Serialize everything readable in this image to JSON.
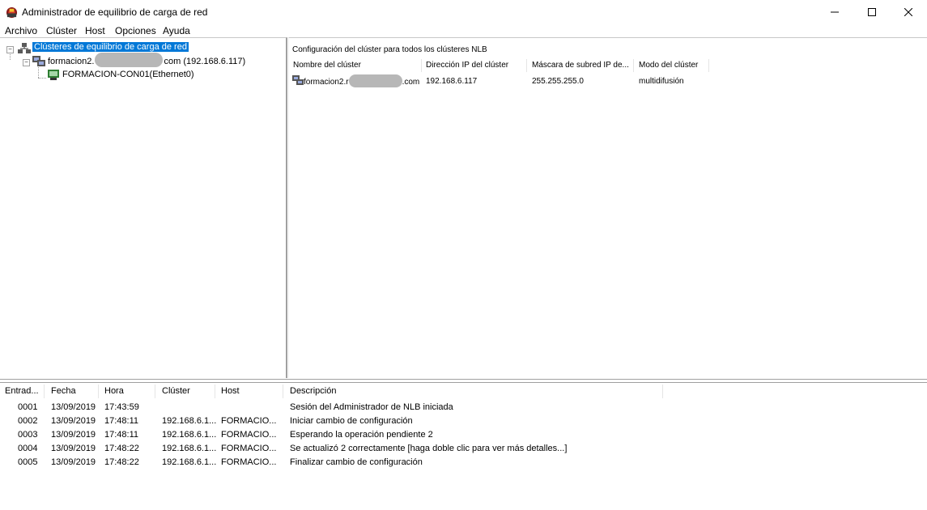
{
  "window": {
    "title": "Administrador de equilibrio de carga de red",
    "icon": "nlb-manager-icon",
    "controls": [
      "minimize",
      "maximize",
      "close"
    ]
  },
  "menu": {
    "items": [
      "Archivo",
      "Clúster",
      "Host",
      "Opciones",
      "Ayuda"
    ]
  },
  "tree": {
    "root_label": "Clústeres de equilibrio de carga de red",
    "cluster_prefix": "formacion2.",
    "cluster_suffix": "com (192.168.6.117)",
    "host_label": "FORMACION-CON01(Ethernet0)"
  },
  "cluster_panel": {
    "title": "Configuración del clúster para todos los clústeres NLB",
    "columns": [
      "Nombre del clúster",
      "Dirección IP del clúster",
      "Máscara de subred IP de...",
      "Modo del clúster"
    ],
    "row": {
      "name_prefix": "formacion2.r",
      "name_suffix": ".com",
      "ip": "192.168.6.117",
      "mask": "255.255.255.0",
      "mode": "multidifusión"
    }
  },
  "log": {
    "columns": [
      "Entrad...",
      "Fecha",
      "Hora",
      "Clúster",
      "Host",
      "Descripción"
    ],
    "rows": [
      {
        "entry": "0001",
        "date": "13/09/2019",
        "time": "17:43:59",
        "cluster": "",
        "host": "",
        "desc": "Sesión del Administrador de NLB iniciada"
      },
      {
        "entry": "0002",
        "date": "13/09/2019",
        "time": "17:48:11",
        "cluster": "192.168.6.1...",
        "host": "FORMACIO...",
        "desc": "Iniciar cambio de configuración"
      },
      {
        "entry": "0003",
        "date": "13/09/2019",
        "time": "17:48:11",
        "cluster": "192.168.6.1...",
        "host": "FORMACIO...",
        "desc": "Esperando la operación pendiente 2"
      },
      {
        "entry": "0004",
        "date": "13/09/2019",
        "time": "17:48:22",
        "cluster": "192.168.6.1...",
        "host": "FORMACIO...",
        "desc": "Se actualizó 2 correctamente [haga doble clic para ver más detalles...]"
      },
      {
        "entry": "0005",
        "date": "13/09/2019",
        "time": "17:48:22",
        "cluster": "192.168.6.1...",
        "host": "FORMACIO...",
        "desc": "Finalizar cambio de configuración"
      }
    ]
  },
  "colors": {
    "selection": "#0078d7",
    "divider": "#a0a0a0"
  }
}
